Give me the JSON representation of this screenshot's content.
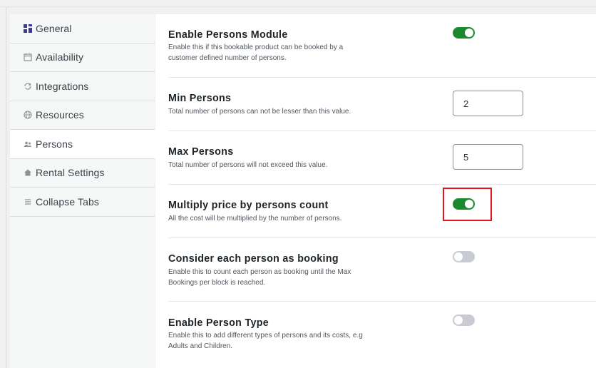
{
  "sidebar": {
    "items": [
      {
        "label": "General",
        "icon": "grid-icon"
      },
      {
        "label": "Availability",
        "icon": "calendar-icon"
      },
      {
        "label": "Integrations",
        "icon": "sync-icon"
      },
      {
        "label": "Resources",
        "icon": "globe-icon"
      },
      {
        "label": "Persons",
        "icon": "users-icon"
      },
      {
        "label": "Rental Settings",
        "icon": "home-icon"
      },
      {
        "label": "Collapse Tabs",
        "icon": "menu-icon"
      }
    ],
    "active": "Persons"
  },
  "settings": {
    "enable_persons": {
      "title": "Enable Persons Module",
      "desc": "Enable this if this bookable product can be booked by a customer defined number of persons.",
      "enabled": true
    },
    "min_persons": {
      "title": "Min Persons",
      "desc": "Total number of persons can not be lesser than this value.",
      "value": "2"
    },
    "max_persons": {
      "title": "Max Persons",
      "desc": "Total number of persons will not exceed this value.",
      "value": "5"
    },
    "multiply_price": {
      "title": "Multiply price by persons count",
      "desc": "All the cost will be multiplied by the number of persons.",
      "enabled": true
    },
    "each_person_booking": {
      "title": "Consider each person as booking",
      "desc": "Enable this to count each person as booking until the Max Bookings per block is reached.",
      "enabled": false
    },
    "person_type": {
      "title": "Enable Person Type",
      "desc": "Enable this to add different types of persons and its costs, e.g Adults and Children.",
      "enabled": false
    }
  },
  "colors": {
    "toggle_on": "#1a8a2c",
    "toggle_off": "#c8ccd2",
    "highlight": "#e0141b",
    "accent": "#3858e9"
  }
}
